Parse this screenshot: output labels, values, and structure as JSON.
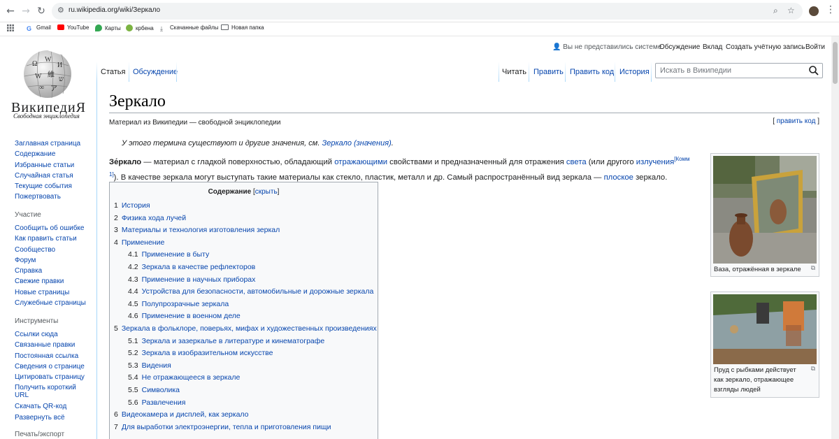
{
  "browser": {
    "url": "ru.wikipedia.org/wiki/Зеркало",
    "bookmarks": [
      "Gmail",
      "YouTube",
      "Карты",
      "крбена",
      "Скачанные файлы",
      "Новая папка"
    ]
  },
  "wiki": {
    "wordmark": "ВикипедиЯ",
    "tagline": "Свободная энциклопедия",
    "nav": [
      "Заглавная страница",
      "Содержание",
      "Избранные статьи",
      "Случайная статья",
      "Текущие события",
      "Пожертвовать"
    ],
    "participation": {
      "heading": "Участие",
      "items": [
        "Сообщить об ошибке",
        "Как править статьи",
        "Сообщество",
        "Форум",
        "Справка",
        "Свежие правки",
        "Новые страницы",
        "Служебные страницы"
      ]
    },
    "tools": {
      "heading": "Инструменты",
      "items": [
        "Ссылки сюда",
        "Связанные правки",
        "Постоянная ссылка",
        "Сведения о странице",
        "Цитировать страницу",
        "Получить короткий URL",
        "Скачать QR-код",
        "Развернуть всё"
      ]
    },
    "print_heading": "Печать/экспорт",
    "personal": {
      "status": "Вы не представились системе",
      "links": [
        "Обсуждение",
        "Вклад",
        "Создать учётную запись",
        "Войти"
      ]
    },
    "tabs_left": [
      "Статья",
      "Обсуждение"
    ],
    "tabs_right": [
      "Читать",
      "Править",
      "Править код",
      "История"
    ],
    "search_placeholder": "Искать в Википедии"
  },
  "article": {
    "title": "Зеркало",
    "from": "Материал из Википедии — свободной энциклопедии",
    "edit_link": "править код",
    "hatnote_text": "У этого термина существуют и другие значения, см.",
    "hatnote_link": "Зеркало (значения)",
    "lead": {
      "term": "Зе́ркало",
      "p1": " — материал с гладкой поверхностью, обладающий ",
      "l1": "отражающими",
      "p2": " свойствами и предназначенный для отражения ",
      "l2": "света",
      "p3": " (или другого ",
      "l3": "излучения",
      "sup": "[Комм 1]",
      "p4": "). В качестве зеркала могут выступать такие материалы как стекло, пластик, металл и др. Самый распространённый вид зеркала — ",
      "l4": "плоское",
      "p5": " зеркало."
    },
    "toc": {
      "title": "Содержание",
      "toggle": "скрыть",
      "items": [
        {
          "num": "1",
          "text": "История",
          "level": 1
        },
        {
          "num": "2",
          "text": "Физика хода лучей",
          "level": 1
        },
        {
          "num": "3",
          "text": "Материалы и технология изготовления зеркал",
          "level": 1
        },
        {
          "num": "4",
          "text": "Применение",
          "level": 1
        },
        {
          "num": "4.1",
          "text": "Применение в быту",
          "level": 2
        },
        {
          "num": "4.2",
          "text": "Зеркала в качестве рефлекторов",
          "level": 2
        },
        {
          "num": "4.3",
          "text": "Применение в научных приборах",
          "level": 2
        },
        {
          "num": "4.4",
          "text": "Устройства для безопасности, автомобильные и дорожные зеркала",
          "level": 2
        },
        {
          "num": "4.5",
          "text": "Полупрозрачные зеркала",
          "level": 2
        },
        {
          "num": "4.6",
          "text": "Применение в военном деле",
          "level": 2
        },
        {
          "num": "5",
          "text": "Зеркала в фольклоре, поверьях, мифах и художественных произведениях",
          "level": 1
        },
        {
          "num": "5.1",
          "text": "Зеркала и зазеркалье в литературе и кинематографе",
          "level": 2
        },
        {
          "num": "5.2",
          "text": "Зеркала в изобразительном искусстве",
          "level": 2
        },
        {
          "num": "5.3",
          "text": "Видения",
          "level": 2
        },
        {
          "num": "5.4",
          "text": "Не отражающееся в зеркале",
          "level": 2
        },
        {
          "num": "5.5",
          "text": "Символика",
          "level": 2
        },
        {
          "num": "5.6",
          "text": "Развлечения",
          "level": 2
        },
        {
          "num": "6",
          "text": "Видеокамера и дисплей, как зеркало",
          "level": 1
        },
        {
          "num": "7",
          "text": "Для выработки электроэнергии, тепла и приготовления пищи",
          "level": 1
        }
      ]
    },
    "thumb1_caption": "Ваза, отражённая в зеркале",
    "thumb2_caption": "Пруд с рыбками действует как зеркало, отражающее взгляды людей"
  }
}
